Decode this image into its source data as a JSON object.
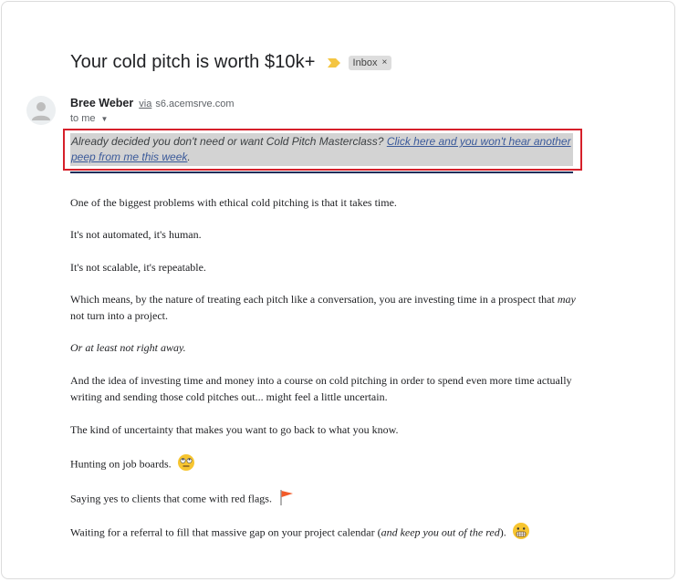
{
  "email": {
    "subject": "Your cold pitch is worth $10k+",
    "label": "Inbox",
    "label_close": "×",
    "sender": {
      "name": "Bree Weber",
      "via": "via",
      "domain": "s6.acemsrve.com"
    },
    "to": "to me",
    "unsubscribe": {
      "lead": "Already decided you don't need or want Cold Pitch Masterclass? ",
      "link": "Click here and you won't hear another peep from me this week",
      "trail": "."
    },
    "paragraphs": {
      "p1": "One of the biggest problems with ethical cold pitching is that it takes time.",
      "p2": "It's not automated, it's human.",
      "p3": "It's not scalable, it's repeatable.",
      "p4_a": "Which means, by the nature of treating each pitch like a conversation, you are investing time in a prospect that ",
      "p4_em": "may",
      "p4_b": " not turn into a project.",
      "p5": "Or at least not right away.",
      "p6": "And the idea of investing time and money into a course on cold pitching in order to spend even more time actually writing and sending those cold pitches out... might feel a little uncertain.",
      "p7": "The kind of uncertainty that makes you want to go back to what you know.",
      "p8": "Hunting on job boards.",
      "p9": "Saying yes to clients that come with red flags.",
      "p10_a": "Waiting for a referral to fill that massive gap on your project calendar (",
      "p10_em": "and keep you out of the red",
      "p10_b": ")."
    },
    "icons": {
      "importance": "importance-marker-icon",
      "avatar": "default-avatar-icon",
      "eye_roll": "eye-roll-emoji-icon",
      "red_flag": "red-flag-emoji-icon",
      "grimace": "grimacing-emoji-icon"
    },
    "colors": {
      "importance_marker": "#f4c542",
      "highlight_border": "#d6202a",
      "link": "#3b5a9a",
      "rule": "#1f2d5a"
    }
  }
}
